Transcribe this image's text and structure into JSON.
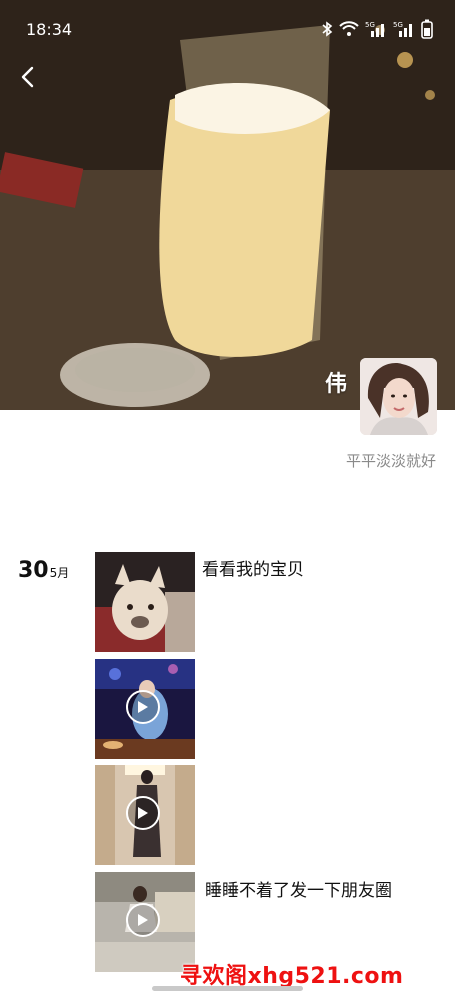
{
  "status_bar": {
    "time": "18:34",
    "icons": [
      "bluetooth-icon",
      "wifi-icon",
      "5g-signal-icon",
      "5g-signal-icon",
      "battery-icon"
    ],
    "signal_labels": [
      "5G",
      "5G"
    ]
  },
  "header": {
    "back_icon": "chevron-left-icon"
  },
  "profile": {
    "name": "伟",
    "signature": "平平淡淡就好"
  },
  "posts": [
    {
      "day": "30",
      "month": "5月",
      "text": "看看我的宝贝",
      "media": "photo"
    },
    {
      "media": "video"
    },
    {
      "media": "video"
    },
    {
      "text": "睡睡不着了发一下朋友圈",
      "media": "video"
    }
  ],
  "watermark": "寻欢阁xhg521.com",
  "colors": {
    "background": "#ffffff",
    "signature_text": "#8a8a8a",
    "watermark": "#ee1111"
  }
}
